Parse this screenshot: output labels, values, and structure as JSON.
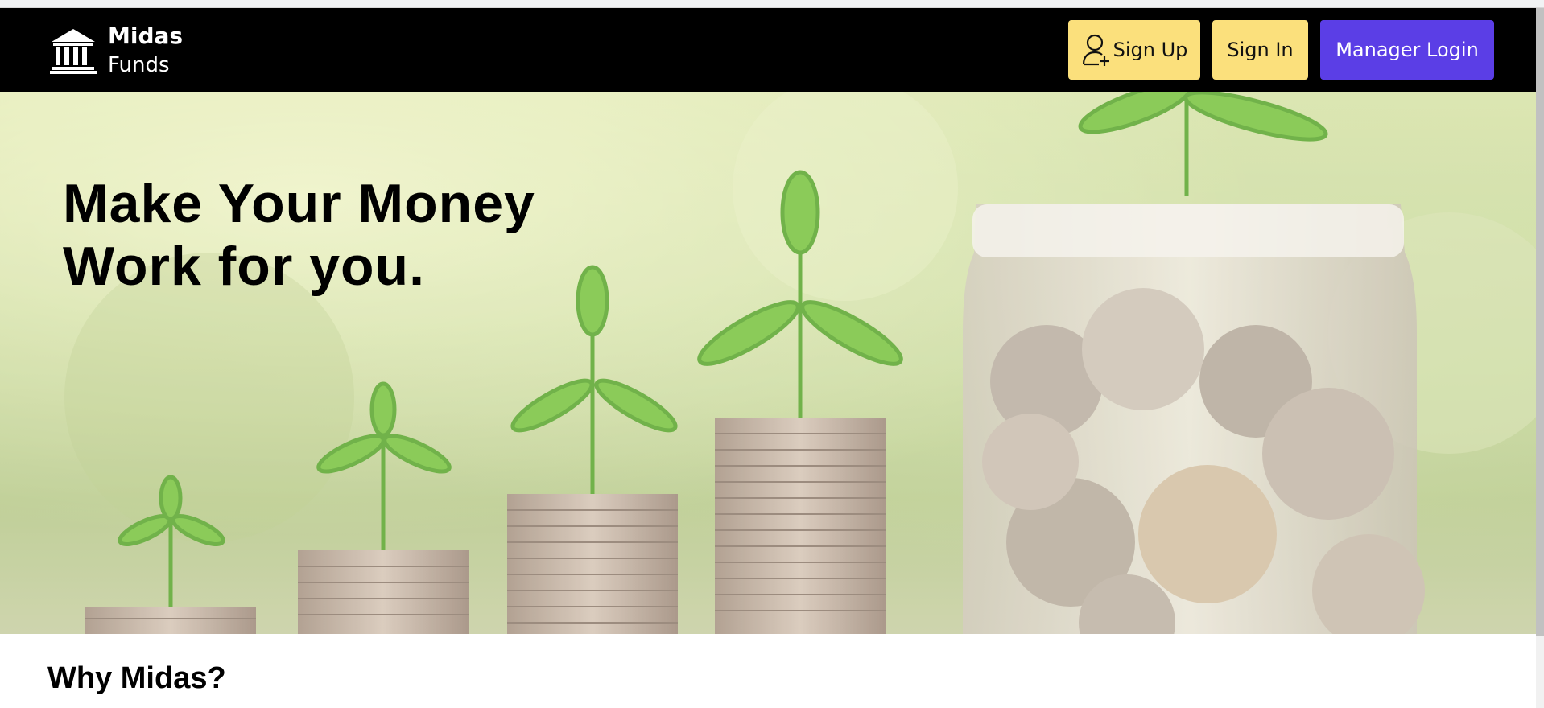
{
  "brand": {
    "name": "Midas",
    "subtitle": "Funds",
    "icon": "bank-building-icon"
  },
  "nav": {
    "signup_label": "Sign Up",
    "signup_icon": "user-add-icon",
    "signin_label": "Sign In",
    "manager_label": "Manager Login"
  },
  "hero": {
    "title_line1": "Make Your Money",
    "title_line2": "Work for you.",
    "image_subject": "coin-stacks-with-seedlings-and-jar-of-coins"
  },
  "section": {
    "why_title": "Why Midas?"
  },
  "colors": {
    "navbar_bg": "#000000",
    "button_yellow": "#fbe07c",
    "button_purple": "#5b3ee6",
    "text_white": "#ffffff"
  }
}
